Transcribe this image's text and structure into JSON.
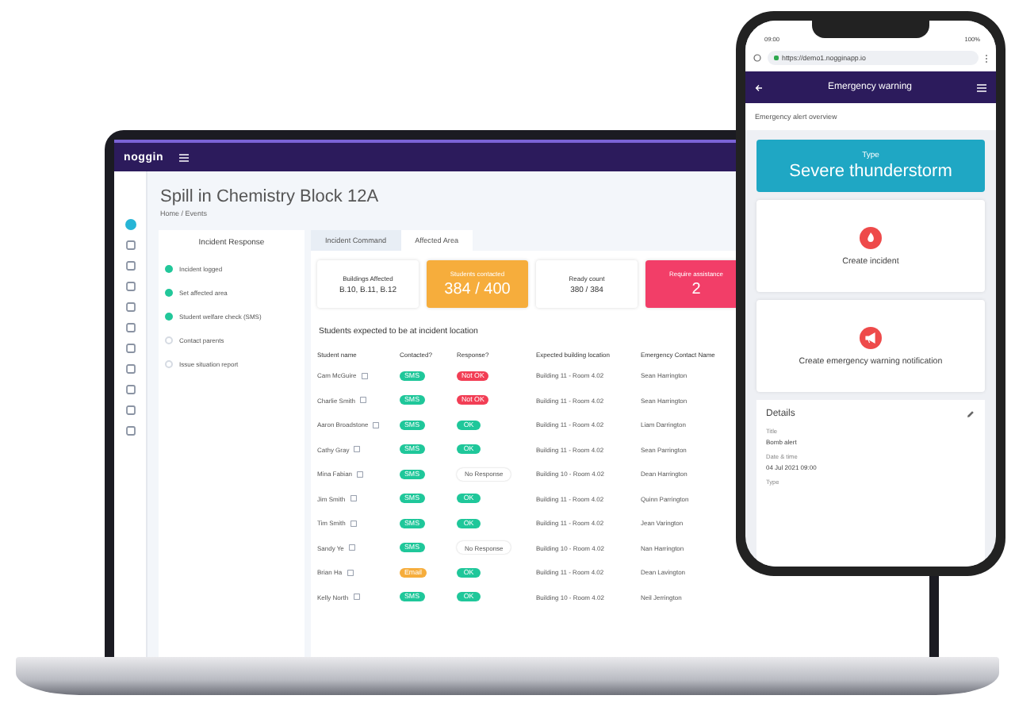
{
  "laptop": {
    "logo": "noggin",
    "title": "Spill in Chemistry Block 12A",
    "breadcrumb": "Home / Events",
    "nav": [
      {
        "selected": true
      },
      {
        "selected": false
      },
      {
        "selected": false
      },
      {
        "selected": false
      },
      {
        "selected": false
      },
      {
        "selected": false
      },
      {
        "selected": false
      },
      {
        "selected": false
      },
      {
        "selected": false
      },
      {
        "selected": false
      },
      {
        "selected": false
      }
    ],
    "panel_title": "Incident Response",
    "steps": [
      {
        "label": "Incident logged",
        "done": true
      },
      {
        "label": "Set affected area",
        "done": true
      },
      {
        "label": "Student welfare check (SMS)",
        "done": true
      },
      {
        "label": "Contact parents",
        "done": false
      },
      {
        "label": "Issue situation report",
        "done": false
      }
    ],
    "tabs": [
      {
        "label": "Incident Command",
        "selected": false
      },
      {
        "label": "Affected Area",
        "selected": true
      }
    ],
    "stats": [
      {
        "label": "Buildings Affected",
        "value": "B.10, B.11, B.12",
        "kind": "plain",
        "color": "#ffffff"
      },
      {
        "label": "Students contacted",
        "value": "384 / 400",
        "kind": "highlight",
        "color": "#f6ad3c"
      },
      {
        "label": "Ready count",
        "value": "380 / 384",
        "kind": "plain",
        "color": "#ffffff"
      },
      {
        "label": "Require assistance",
        "value": "2",
        "kind": "highlight",
        "color": "#f23e68"
      }
    ],
    "table": {
      "title": "Students expected to be at incident location",
      "columns": [
        "Student name",
        "Contacted?",
        "Response?",
        "Expected building location",
        "Emergency Contact Name"
      ],
      "rows": [
        {
          "name": "Cam McGuire",
          "contacted": {
            "text": "SMS",
            "color": "#1fc79a"
          },
          "response": {
            "kind": "badge",
            "text": "Not OK",
            "color": "#f23e55"
          },
          "location": "Building 11 - Room 4.02",
          "contact": "Sean Harrington"
        },
        {
          "name": "Charlie Smith",
          "contacted": {
            "text": "SMS",
            "color": "#1fc79a"
          },
          "response": {
            "kind": "badge",
            "text": "Not OK",
            "color": "#f23e55"
          },
          "location": "Building 11 - Room 4.02",
          "contact": "Sean Harrington"
        },
        {
          "name": "Aaron Broadstone",
          "contacted": {
            "text": "SMS",
            "color": "#1fc79a"
          },
          "response": {
            "kind": "badge",
            "text": "OK",
            "color": "#1fc79a"
          },
          "location": "Building 11 - Room 4.02",
          "contact": "Liam Darrington"
        },
        {
          "name": "Cathy Gray",
          "contacted": {
            "text": "SMS",
            "color": "#1fc79a"
          },
          "response": {
            "kind": "badge",
            "text": "OK",
            "color": "#1fc79a"
          },
          "location": "Building 11 - Room 4.02",
          "contact": "Sean Parrington"
        },
        {
          "name": "Mina Fabian",
          "contacted": {
            "text": "SMS",
            "color": "#1fc79a"
          },
          "response": {
            "kind": "plain",
            "text": "No Response",
            "color": "#ffffff"
          },
          "location": "Building 10 - Room 4.02",
          "contact": "Dean Harrington"
        },
        {
          "name": "Jim Smith",
          "contacted": {
            "text": "SMS",
            "color": "#1fc79a"
          },
          "response": {
            "kind": "badge",
            "text": "OK",
            "color": "#1fc79a"
          },
          "location": "Building 11 - Room 4.02",
          "contact": "Quinn Parrington"
        },
        {
          "name": "Tim Smith",
          "contacted": {
            "text": "SMS",
            "color": "#1fc79a"
          },
          "response": {
            "kind": "badge",
            "text": "OK",
            "color": "#1fc79a"
          },
          "location": "Building 11 - Room 4.02",
          "contact": "Jean Varington"
        },
        {
          "name": "Sandy Ye",
          "contacted": {
            "text": "SMS",
            "color": "#1fc79a"
          },
          "response": {
            "kind": "plain",
            "text": "No Response",
            "color": "#ffffff"
          },
          "location": "Building 10 - Room 4.02",
          "contact": "Nan Harrington"
        },
        {
          "name": "Brian Ha",
          "contacted": {
            "text": "Email",
            "color": "#f6ad3c"
          },
          "response": {
            "kind": "badge",
            "text": "OK",
            "color": "#1fc79a"
          },
          "location": "Building 11 - Room 4.02",
          "contact": "Dean Lavington"
        },
        {
          "name": "Kelly North",
          "contacted": {
            "text": "SMS",
            "color": "#1fc79a"
          },
          "response": {
            "kind": "badge",
            "text": "OK",
            "color": "#1fc79a"
          },
          "location": "Building 10 - Room 4.02",
          "contact": "Neil Jerrington"
        }
      ]
    }
  },
  "phone": {
    "time": "09:00",
    "battery": "100%",
    "url": "https://demo1.nogginapp.io",
    "header": "Emergency warning",
    "overview": "Emergency alert overview",
    "type_label": "Type",
    "type_value": "Severe thunderstorm",
    "actions": [
      "Create incident",
      "Create emergency warning notification"
    ],
    "details": {
      "title": "Details",
      "fields": [
        {
          "label": "Title",
          "value": "Bomb alert"
        },
        {
          "label": "Date & time",
          "value": "04 Jul 2021 09:00"
        },
        {
          "label": "Type"
        }
      ]
    }
  }
}
